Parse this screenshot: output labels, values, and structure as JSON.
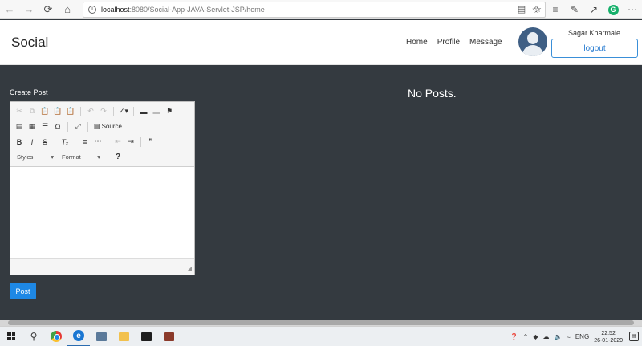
{
  "browser": {
    "url_host": "localhost",
    "url_path": ":8080/Social-App-JAVA-Servlet-JSP/home",
    "extension_letter": "G"
  },
  "navbar": {
    "brand": "Social",
    "links": [
      "Home",
      "Profile",
      "Message"
    ],
    "username": "Sagar Kharmale",
    "logout_label": "logout"
  },
  "main": {
    "create_post_label": "Create Post",
    "no_posts_text": "No Posts.",
    "post_button_label": "Post"
  },
  "editor": {
    "source_label": "Source",
    "styles_label": "Styles",
    "format_label": "Format",
    "help_label": "?"
  },
  "taskbar": {
    "language": "ENG",
    "time": "22:52",
    "date": "26-01-2020"
  }
}
